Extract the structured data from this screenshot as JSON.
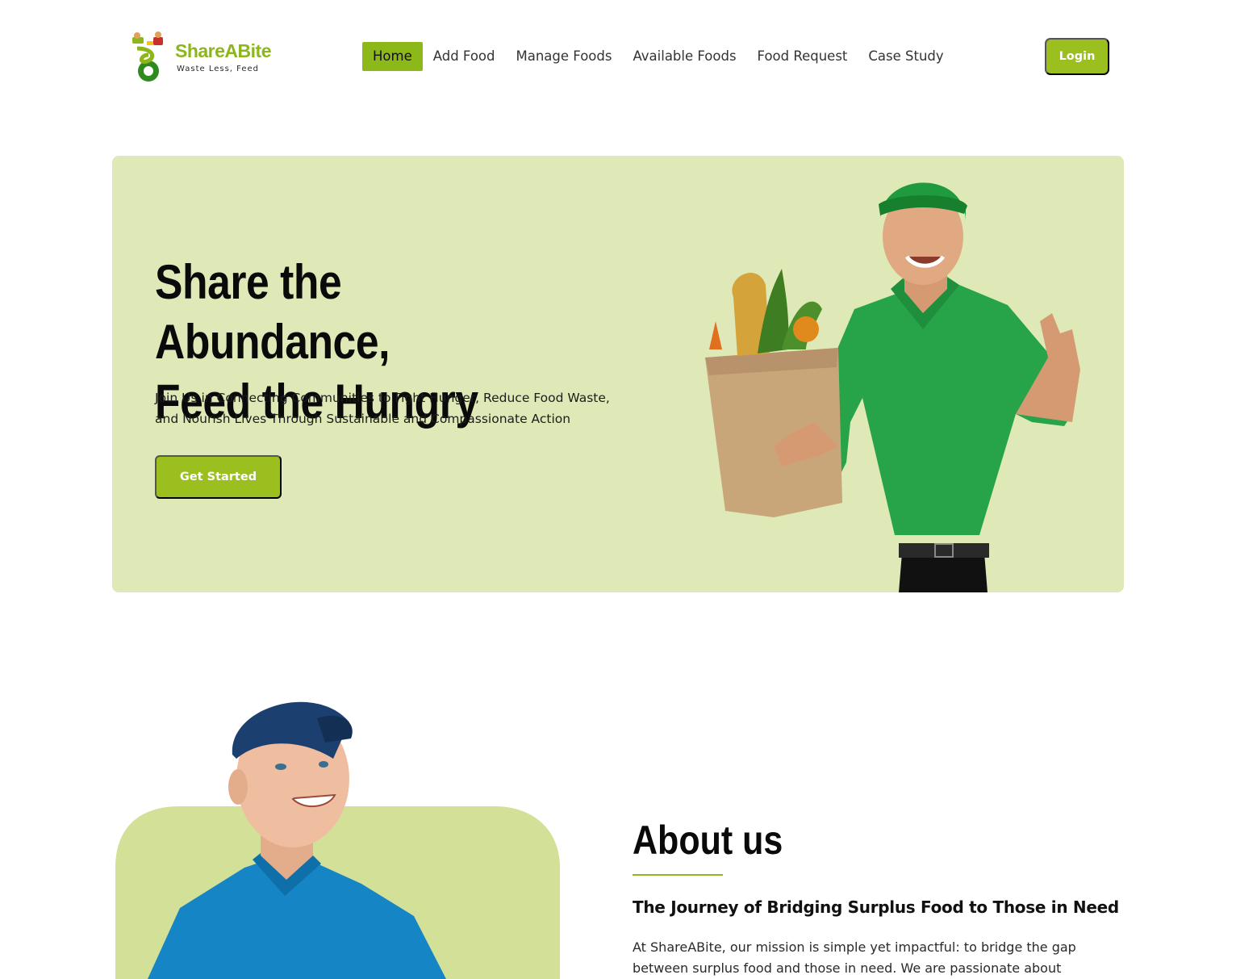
{
  "brand": {
    "name": "ShareABite",
    "tagline": "Waste Less, Feed",
    "accent": "#9abf1e",
    "hero_bg": "#dfe9b8",
    "about_bg": "#d2e197"
  },
  "nav": {
    "items": [
      {
        "label": "Home",
        "active": true
      },
      {
        "label": "Add Food",
        "active": false
      },
      {
        "label": "Manage Foods",
        "active": false
      },
      {
        "label": "Available Foods",
        "active": false
      },
      {
        "label": "Food Request",
        "active": false
      },
      {
        "label": "Case Study",
        "active": false
      }
    ],
    "login_label": "Login"
  },
  "hero": {
    "title_line1": "Share the Abundance,",
    "title_line2": "Feed the Hungry",
    "subtitle_line1": "Join Us in Connecting Communities to Fight Hunger, Reduce Food Waste,",
    "subtitle_line2": "and Nourish Lives Through Sustainable and Compassionate Action",
    "cta_label": "Get Started"
  },
  "about": {
    "title": "About us",
    "subtitle": "The Journey of Bridging Surplus Food to Those in Need",
    "body_line1": "At ShareABite, our mission is simple yet impactful: to bridge the gap",
    "body_line2": "between surplus food and those in need. We are passionate about"
  }
}
